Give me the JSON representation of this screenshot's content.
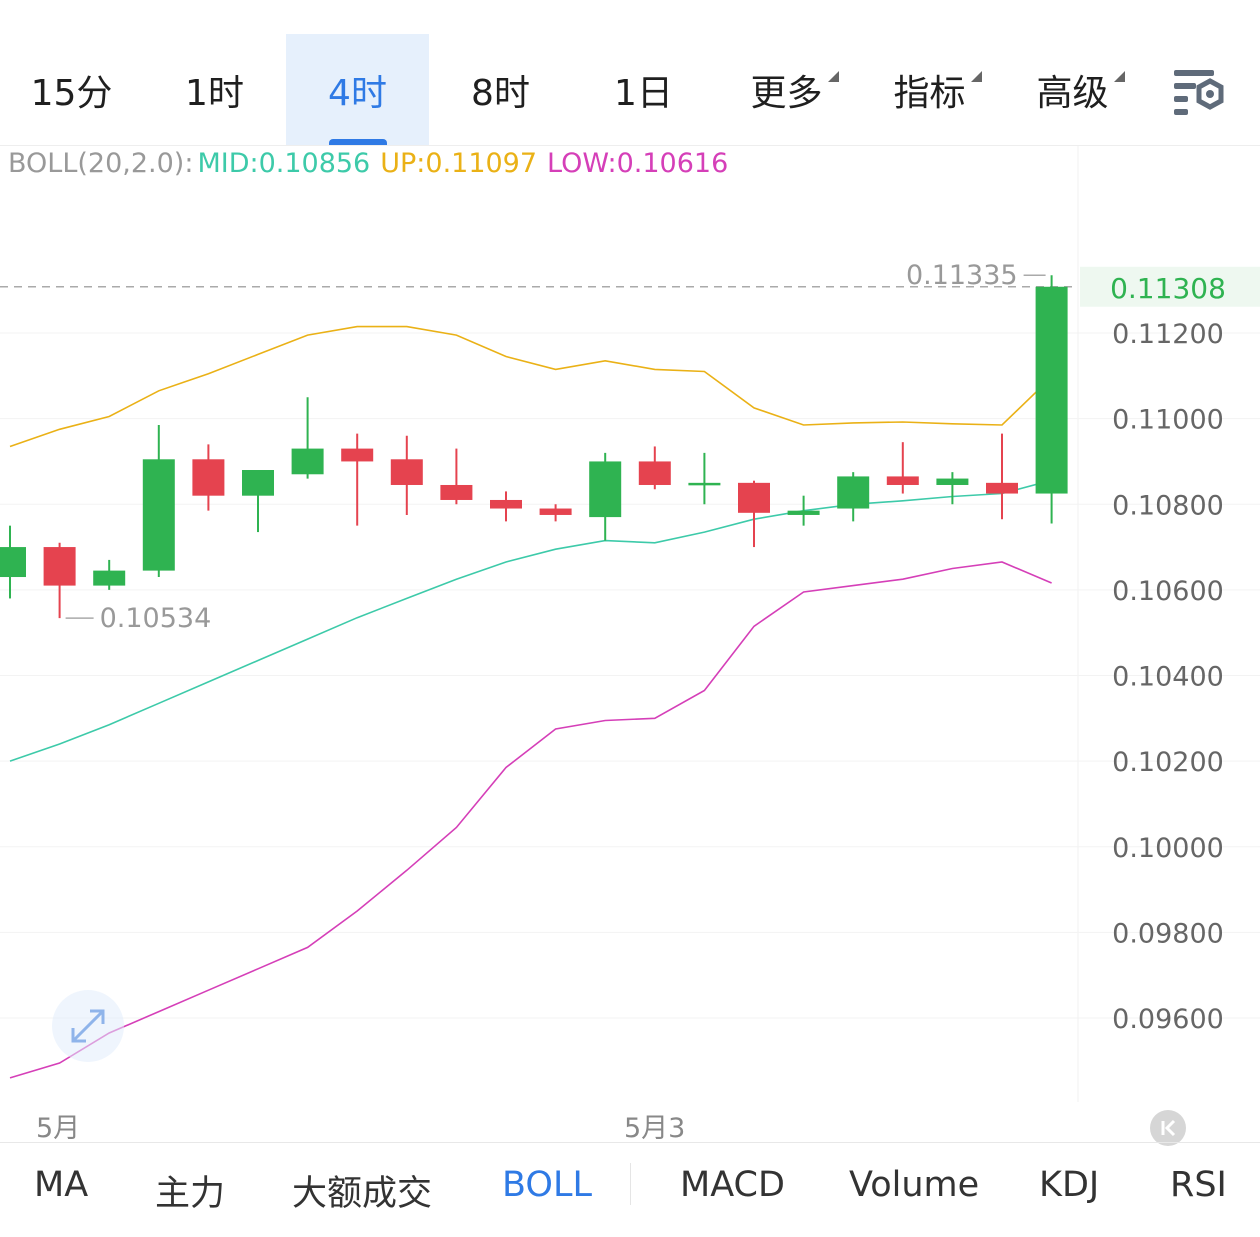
{
  "periods": [
    {
      "label": "15分"
    },
    {
      "label": "1时"
    },
    {
      "label": "4时",
      "active": true
    },
    {
      "label": "8时"
    },
    {
      "label": "1日"
    },
    {
      "label": "更多",
      "dropdown": true
    },
    {
      "label": "指标",
      "dropdown": true
    },
    {
      "label": "高级",
      "dropdown": true
    }
  ],
  "icons": {
    "settings": "settings-gear-icon",
    "zoom": "expand-arrows-icon",
    "back": "back-to-latest-icon"
  },
  "legend": {
    "name": "BOLL(20,2.0):",
    "mid": "MID:0.10856",
    "up": "UP:0.11097",
    "low": "LOW:0.10616"
  },
  "colors": {
    "up_candle": "#2fb351",
    "down_candle": "#e5434f",
    "mid": "#3dcaa9",
    "upper": "#eab116",
    "lower": "#d53fb8",
    "accent": "#2f7ae5",
    "legend_gray": "#999999"
  },
  "chart_data": {
    "type": "candlestick",
    "title": "",
    "indicator": "BOLL",
    "yaxis_ticks": [
      "0.11200",
      "0.11000",
      "0.10800",
      "0.10600",
      "0.10400",
      "0.10200",
      "0.10000",
      "0.09800",
      "0.09600"
    ],
    "ylim": [
      0.0945,
      0.1158
    ],
    "current_price": "0.11308",
    "high_marker": "0.11335",
    "low_marker": "0.10534",
    "x_labels": [
      {
        "label": "5月",
        "index": 1
      },
      {
        "label": "5月3",
        "index": 13
      }
    ],
    "candles": [
      {
        "o": 0.1063,
        "h": 0.1075,
        "l": 0.1058,
        "c": 0.107
      },
      {
        "o": 0.107,
        "h": 0.1071,
        "l": 0.10534,
        "c": 0.1061
      },
      {
        "o": 0.1061,
        "h": 0.1067,
        "l": 0.106,
        "c": 0.10645
      },
      {
        "o": 0.10645,
        "h": 0.10985,
        "l": 0.1063,
        "c": 0.10905
      },
      {
        "o": 0.10905,
        "h": 0.1094,
        "l": 0.10785,
        "c": 0.1082
      },
      {
        "o": 0.1082,
        "h": 0.1088,
        "l": 0.10735,
        "c": 0.1088
      },
      {
        "o": 0.1087,
        "h": 0.1105,
        "l": 0.1086,
        "c": 0.1093
      },
      {
        "o": 0.1093,
        "h": 0.10965,
        "l": 0.1075,
        "c": 0.109
      },
      {
        "o": 0.10905,
        "h": 0.1096,
        "l": 0.10775,
        "c": 0.10845
      },
      {
        "o": 0.10845,
        "h": 0.1093,
        "l": 0.108,
        "c": 0.1081
      },
      {
        "o": 0.1081,
        "h": 0.1083,
        "l": 0.1076,
        "c": 0.1079
      },
      {
        "o": 0.1079,
        "h": 0.108,
        "l": 0.1076,
        "c": 0.10775
      },
      {
        "o": 0.1077,
        "h": 0.1092,
        "l": 0.10715,
        "c": 0.109
      },
      {
        "o": 0.109,
        "h": 0.10935,
        "l": 0.10835,
        "c": 0.10845
      },
      {
        "o": 0.10845,
        "h": 0.1092,
        "l": 0.108,
        "c": 0.1085
      },
      {
        "o": 0.1085,
        "h": 0.10855,
        "l": 0.107,
        "c": 0.1078
      },
      {
        "o": 0.10775,
        "h": 0.1082,
        "l": 0.1075,
        "c": 0.10785
      },
      {
        "o": 0.1079,
        "h": 0.10875,
        "l": 0.1076,
        "c": 0.10865
      },
      {
        "o": 0.10865,
        "h": 0.10945,
        "l": 0.10825,
        "c": 0.10845
      },
      {
        "o": 0.10845,
        "h": 0.10875,
        "l": 0.108,
        "c": 0.1086
      },
      {
        "o": 0.1085,
        "h": 0.10965,
        "l": 0.10765,
        "c": 0.10825
      },
      {
        "o": 0.10825,
        "h": 0.11335,
        "l": 0.10755,
        "c": 0.11308
      }
    ],
    "series": [
      {
        "name": "UP",
        "values": [
          0.10935,
          0.10975,
          0.11005,
          0.11065,
          0.11105,
          0.1115,
          0.11195,
          0.11215,
          0.11215,
          0.11195,
          0.11145,
          0.11115,
          0.11135,
          0.11115,
          0.1111,
          0.11025,
          0.10985,
          0.1099,
          0.10992,
          0.10988,
          0.10985,
          0.11097
        ]
      },
      {
        "name": "MID",
        "values": [
          0.102,
          0.1024,
          0.10285,
          0.10335,
          0.10385,
          0.10435,
          0.10485,
          0.10535,
          0.1058,
          0.10625,
          0.10665,
          0.10695,
          0.10715,
          0.1071,
          0.10735,
          0.10765,
          0.10785,
          0.108,
          0.10808,
          0.10818,
          0.10825,
          0.10856
        ]
      },
      {
        "name": "LOW",
        "values": [
          0.0946,
          0.09495,
          0.09565,
          0.09615,
          0.09665,
          0.09715,
          0.09765,
          0.0985,
          0.09945,
          0.10045,
          0.10185,
          0.10275,
          0.10295,
          0.103,
          0.10365,
          0.10515,
          0.10595,
          0.1061,
          0.10625,
          0.1065,
          0.10665,
          0.10616
        ]
      }
    ]
  },
  "indicators": [
    {
      "label": "MA"
    },
    {
      "label": "主力"
    },
    {
      "label": "大额成交"
    },
    {
      "label": "BOLL",
      "active": true
    },
    {
      "label": "MACD"
    },
    {
      "label": "Volume"
    },
    {
      "label": "KDJ"
    },
    {
      "label": "RSI"
    }
  ]
}
